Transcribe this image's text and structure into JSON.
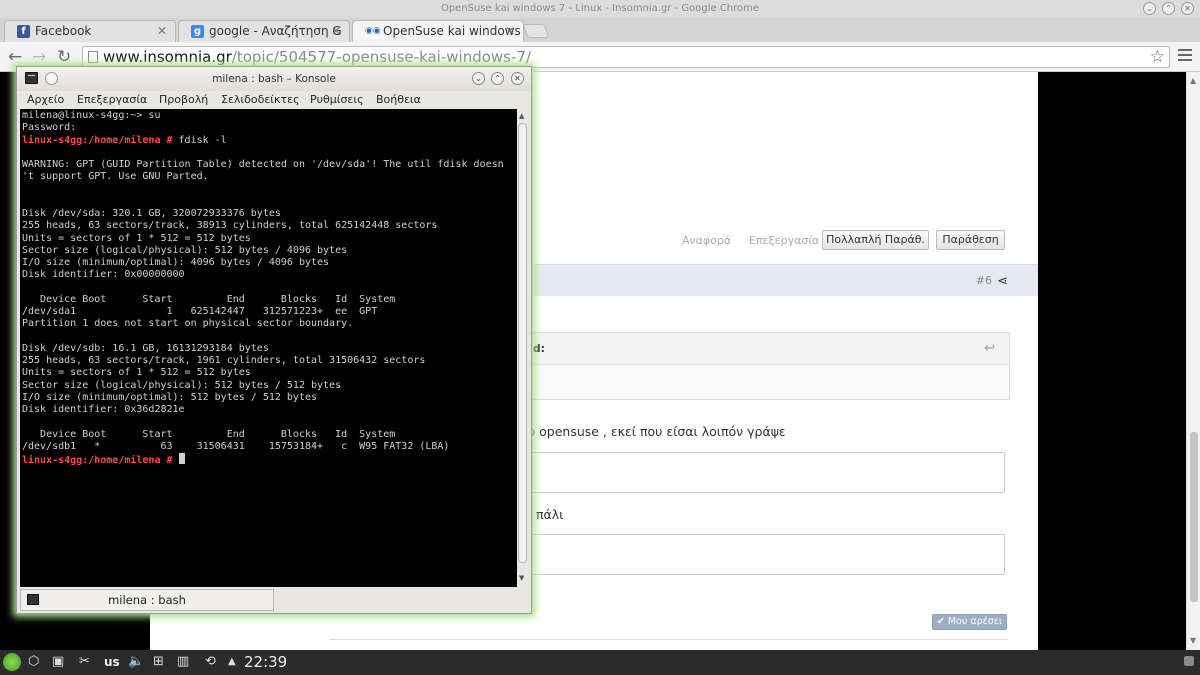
{
  "window": {
    "title": "OpenSuse kai windows 7 - Linux - Insomnia.gr - Google Chrome"
  },
  "tabs": [
    {
      "label": "Facebook",
      "icon": "facebook-icon",
      "color": "#3b5998"
    },
    {
      "label": "google - Αναζήτηση G",
      "icon": "google-icon",
      "color": "#4285f4"
    },
    {
      "label": "OpenSuse kai windows",
      "icon": "insomnia-icon",
      "color": "#1f6fb5"
    }
  ],
  "address": {
    "host": "www.insomnia.gr",
    "path": "/topic/504577-opensuse-kai-windows-7/"
  },
  "page": {
    "report_link": "Αναφορά",
    "edit_link": "Επεξεργασία",
    "multiquote_button": "Πολλαπλή Παράθ.",
    "quote_button": "Παράθεση",
    "post_number": "#6",
    "quote_header": "id:",
    "text1": "το opensuse , εκεί που είσαι λοιπόν γράψε",
    "text2": "πάλι",
    "like_button": "✔ Μου αρέσει"
  },
  "konsole": {
    "title": "milena : bash – Konsole",
    "menu": [
      "Αρχείο",
      "Επεξεργασία",
      "Προβολή",
      "Σελιδοδείκτες",
      "Ρυθμίσεις",
      "Βοήθεια"
    ],
    "tab_label": "milena : bash",
    "lines": [
      {
        "t": "milena@linux-s4gg:~> su",
        "p": ""
      },
      {
        "t": "Password:",
        "p": ""
      },
      {
        "p": "linux-s4gg:/home/milena #",
        "t": " fdisk -l"
      },
      {
        "t": "",
        "p": ""
      },
      {
        "t": "WARNING: GPT (GUID Partition Table) detected on '/dev/sda'! The util fdisk doesn",
        "p": ""
      },
      {
        "t": "'t support GPT. Use GNU Parted.",
        "p": ""
      },
      {
        "t": "",
        "p": ""
      },
      {
        "t": "",
        "p": ""
      },
      {
        "t": "Disk /dev/sda: 320.1 GB, 320072933376 bytes",
        "p": ""
      },
      {
        "t": "255 heads, 63 sectors/track, 38913 cylinders, total 625142448 sectors",
        "p": ""
      },
      {
        "t": "Units = sectors of 1 * 512 = 512 bytes",
        "p": ""
      },
      {
        "t": "Sector size (logical/physical): 512 bytes / 4096 bytes",
        "p": ""
      },
      {
        "t": "I/O size (minimum/optimal): 4096 bytes / 4096 bytes",
        "p": ""
      },
      {
        "t": "Disk identifier: 0x00000000",
        "p": ""
      },
      {
        "t": "",
        "p": ""
      },
      {
        "t": "   Device Boot      Start         End      Blocks   Id  System",
        "p": ""
      },
      {
        "t": "/dev/sda1               1   625142447   312571223+  ee  GPT",
        "p": ""
      },
      {
        "t": "Partition 1 does not start on physical sector boundary.",
        "p": ""
      },
      {
        "t": "",
        "p": ""
      },
      {
        "t": "Disk /dev/sdb: 16.1 GB, 16131293184 bytes",
        "p": ""
      },
      {
        "t": "255 heads, 63 sectors/track, 1961 cylinders, total 31506432 sectors",
        "p": ""
      },
      {
        "t": "Units = sectors of 1 * 512 = 512 bytes",
        "p": ""
      },
      {
        "t": "Sector size (logical/physical): 512 bytes / 512 bytes",
        "p": ""
      },
      {
        "t": "I/O size (minimum/optimal): 512 bytes / 512 bytes",
        "p": ""
      },
      {
        "t": "Disk identifier: 0x36d2821e",
        "p": ""
      },
      {
        "t": "",
        "p": ""
      },
      {
        "t": "   Device Boot      Start         End      Blocks   Id  System",
        "p": ""
      },
      {
        "t": "/dev/sdb1   *          63    31506431    15753184+   c  W95 FAT32 (LBA)",
        "p": ""
      },
      {
        "p": "linux-s4gg:/home/milena #",
        "t": " ",
        "cursor": true
      }
    ]
  },
  "taskbar": {
    "keyboard_layout": "us",
    "clock": "22:39"
  }
}
